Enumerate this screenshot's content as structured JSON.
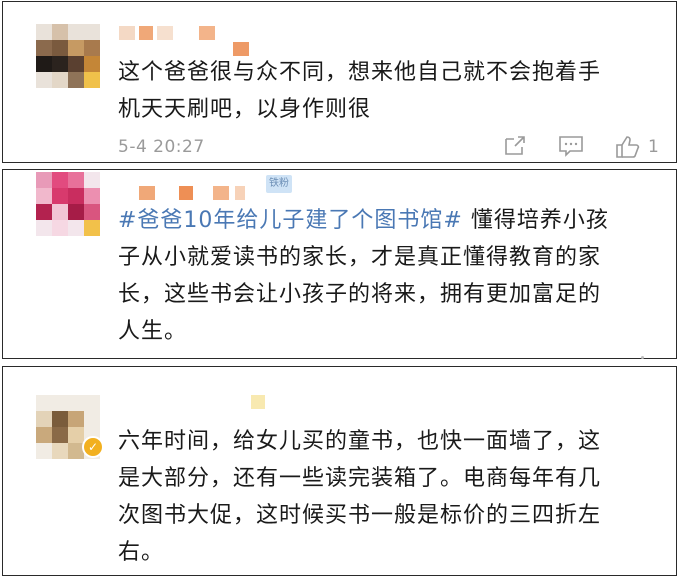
{
  "comments": [
    {
      "text": "这个爸爸很与众不同，想来他自己就不会抱着手\n机天天刷吧，以身作则很",
      "timestamp": "5-4 20:27",
      "like_count": "1",
      "icons": [
        "share-icon",
        "comment-icon",
        "thumbs-up-icon"
      ]
    },
    {
      "hashtag": "#爸爸10年给儿子建了个图书馆#",
      "text": "懂得培养小孩\n子从小就爱读书的家长，才是真正懂得教育的家\n长，这些书会让小孩子的将来，拥有更加富足的\n人生。",
      "badge": "铁粉"
    },
    {
      "text": "六年时间，给女儿买的童书，也快一面墙了，这\n是大部分，还有一些读完装箱了。电商每年有几\n次图书大促，这时候买书一般是标价的三四折左\n右。",
      "verified_icon": "verified-badge-icon"
    }
  ],
  "colors": {
    "hashtag": "#4a78b4",
    "meta_gray": "#9a9a9a",
    "border": "#2a2a2a"
  }
}
